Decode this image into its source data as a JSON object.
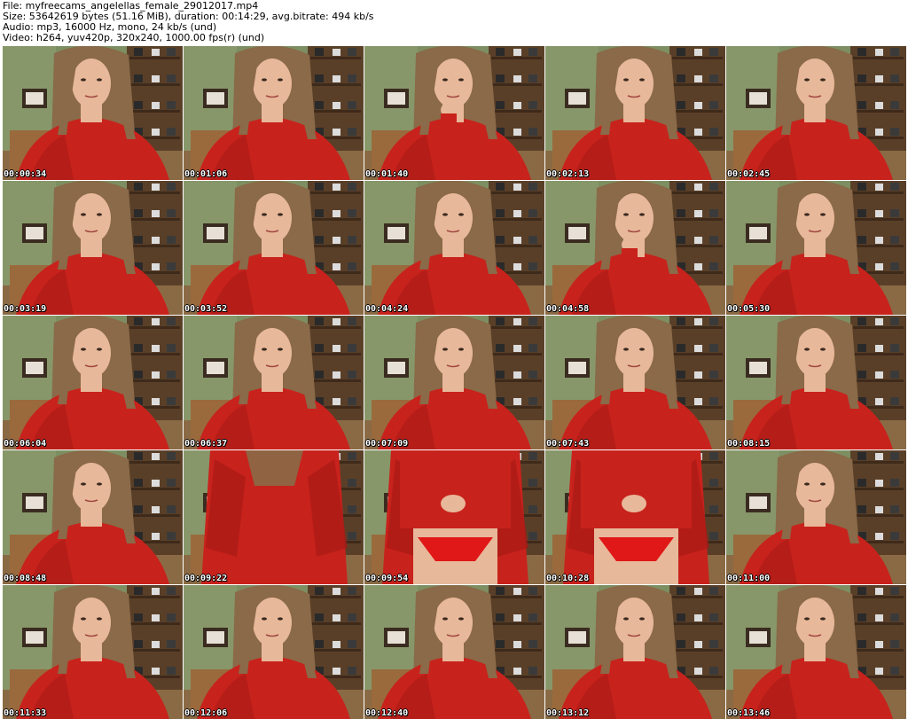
{
  "header": {
    "file_line": "File: myfreecams_angelellas_female_29012017.mp4",
    "size_line": "Size: 53642619 bytes (51.16 MiB), duration: 00:14:29, avg.bitrate: 494 kb/s",
    "audio_line": "Audio: mp3, 16000 Hz, mono, 24 kb/s (und)",
    "video_line": "Video: h264, yuv420p, 320x240, 1000.00 fps(r) (und)"
  },
  "frames": [
    {
      "timestamp": "00:00:34",
      "pose": "head"
    },
    {
      "timestamp": "00:01:06",
      "pose": "head"
    },
    {
      "timestamp": "00:01:40",
      "pose": "hand-chin"
    },
    {
      "timestamp": "00:02:13",
      "pose": "head"
    },
    {
      "timestamp": "00:02:45",
      "pose": "head"
    },
    {
      "timestamp": "00:03:19",
      "pose": "head"
    },
    {
      "timestamp": "00:03:52",
      "pose": "head"
    },
    {
      "timestamp": "00:04:24",
      "pose": "head"
    },
    {
      "timestamp": "00:04:58",
      "pose": "hand-chin"
    },
    {
      "timestamp": "00:05:30",
      "pose": "head"
    },
    {
      "timestamp": "00:06:04",
      "pose": "head"
    },
    {
      "timestamp": "00:06:37",
      "pose": "head"
    },
    {
      "timestamp": "00:07:09",
      "pose": "head"
    },
    {
      "timestamp": "00:07:43",
      "pose": "head"
    },
    {
      "timestamp": "00:08:15",
      "pose": "head"
    },
    {
      "timestamp": "00:08:48",
      "pose": "head"
    },
    {
      "timestamp": "00:09:22",
      "pose": "torso"
    },
    {
      "timestamp": "00:09:54",
      "pose": "torso-legs"
    },
    {
      "timestamp": "00:10:28",
      "pose": "torso-legs"
    },
    {
      "timestamp": "00:11:00",
      "pose": "head"
    },
    {
      "timestamp": "00:11:33",
      "pose": "head"
    },
    {
      "timestamp": "00:12:06",
      "pose": "head"
    },
    {
      "timestamp": "00:12:40",
      "pose": "head"
    },
    {
      "timestamp": "00:13:12",
      "pose": "head"
    },
    {
      "timestamp": "00:13:46",
      "pose": "head"
    }
  ],
  "colors": {
    "background": "#ffffff",
    "wall": "#7d8f62",
    "shelf": "#5a3f28",
    "sweater": "#c8221c",
    "hair": "#8a6a48",
    "skin": "#e8b89a",
    "floor": "#8a6a44",
    "underwear": "#e01818"
  }
}
